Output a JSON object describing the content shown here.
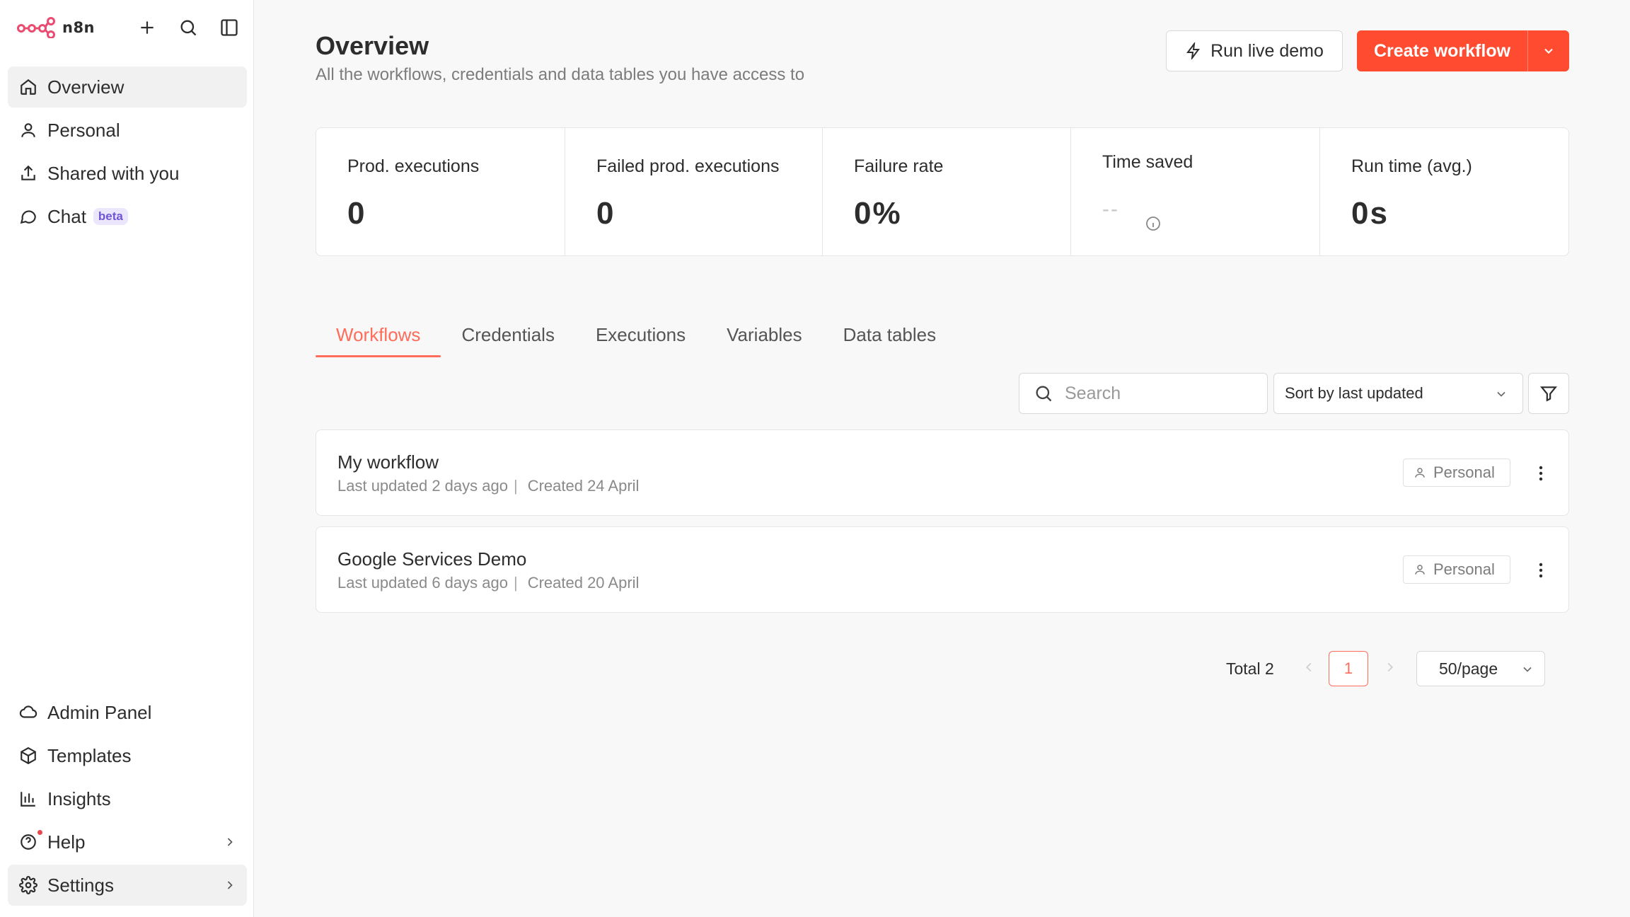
{
  "app": {
    "name": "n8n"
  },
  "sidebar": {
    "items": [
      {
        "label": "Overview",
        "icon": "home-icon"
      },
      {
        "label": "Personal",
        "icon": "user-icon"
      },
      {
        "label": "Shared with you",
        "icon": "share-icon"
      },
      {
        "label": "Chat",
        "icon": "chat-icon",
        "badge": "beta"
      }
    ],
    "bottom_items": [
      {
        "label": "Admin Panel",
        "icon": "cloud-icon"
      },
      {
        "label": "Templates",
        "icon": "box-icon"
      },
      {
        "label": "Insights",
        "icon": "bar-chart-icon"
      },
      {
        "label": "Help",
        "icon": "help-icon"
      },
      {
        "label": "Settings",
        "icon": "gear-icon"
      }
    ]
  },
  "header": {
    "title": "Overview",
    "subtitle": "All the workflows, credentials and data tables you have access to",
    "demo_label": "Run live demo",
    "create_label": "Create workflow"
  },
  "stats": [
    {
      "label": "Prod. executions",
      "value": "0"
    },
    {
      "label": "Failed prod. executions",
      "value": "0"
    },
    {
      "label": "Failure rate",
      "value": "0%"
    },
    {
      "label": "Time saved",
      "value": "--"
    },
    {
      "label": "Run time (avg.)",
      "value": "0s"
    }
  ],
  "tabs": [
    "Workflows",
    "Credentials",
    "Executions",
    "Variables",
    "Data tables"
  ],
  "toolbar": {
    "search_placeholder": "Search",
    "sort_value": "Sort by last updated"
  },
  "workflows": [
    {
      "name": "My workflow",
      "updated": "Last updated 2 days ago",
      "created": "Created 24 April",
      "owner": "Personal"
    },
    {
      "name": "Google Services Demo",
      "updated": "Last updated 6 days ago",
      "created": "Created 20 April",
      "owner": "Personal"
    }
  ],
  "pagination": {
    "total": "Total 2",
    "current": "1",
    "page_size": "50/page"
  },
  "colors": {
    "accent": "#ff6d5a",
    "primary_button": "#ff4b30",
    "beta_badge": "#6e55d6"
  }
}
